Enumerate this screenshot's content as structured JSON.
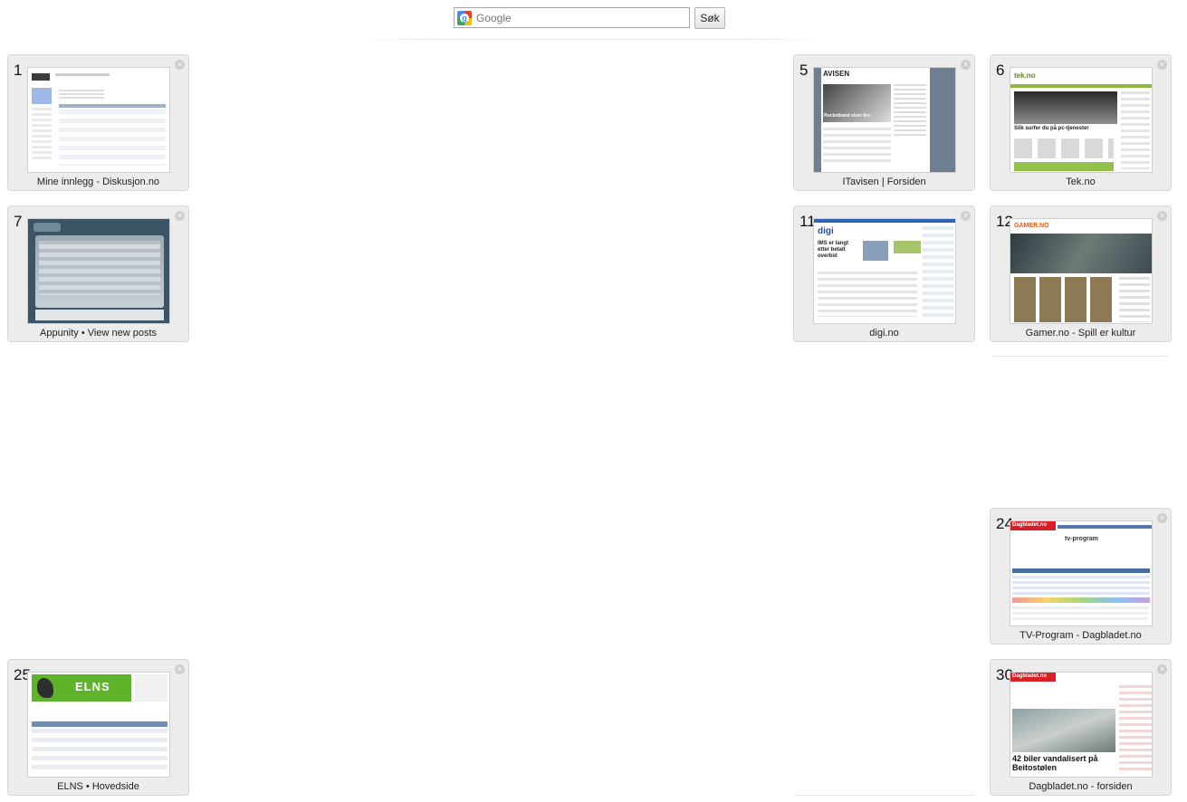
{
  "search": {
    "placeholder": "Google",
    "value": "Google",
    "button_label": "Søk"
  },
  "tiles": [
    {
      "num": "1",
      "title": "Mine innlegg - Diskusjon.no"
    },
    {
      "num": "5",
      "title": "ITavisen | Forsiden",
      "thumb_logo": "AVISEN",
      "thumb_headline": "Rocketband viser fire"
    },
    {
      "num": "6",
      "title": "Tek.no",
      "thumb_logo": "tek.no",
      "thumb_headline": "Slik surfer du på pc-tjenester"
    },
    {
      "num": "7",
      "title": "Appunity • View new posts"
    },
    {
      "num": "11",
      "title": "digi.no",
      "thumb_logo": "digi",
      "thumb_headline": "IMS er langt etter betalt overbid"
    },
    {
      "num": "12",
      "title": "Gamer.no - Spill er kultur",
      "thumb_logo": "GAMER.NO"
    },
    {
      "num": "24",
      "title": "TV-Program - Dagbladet.no",
      "thumb_logo": "Dagbladet.no",
      "thumb_headline": "tv-program"
    },
    {
      "num": "25",
      "title": "ELNS • Hovedside",
      "thumb_logo": "ELNS"
    },
    {
      "num": "30",
      "title": "Dagbladet.no - forsiden",
      "thumb_logo": "Dagbladet.no",
      "thumb_headline": "42 biler vandalisert på Beitostølen"
    }
  ],
  "colors": {
    "tile_bg": "#ececec",
    "tile_border": "#d7d7d7",
    "dagbladet_red": "#d81f26",
    "elns_green": "#5fb32a",
    "itavisen_slate": "#6e7f92"
  }
}
